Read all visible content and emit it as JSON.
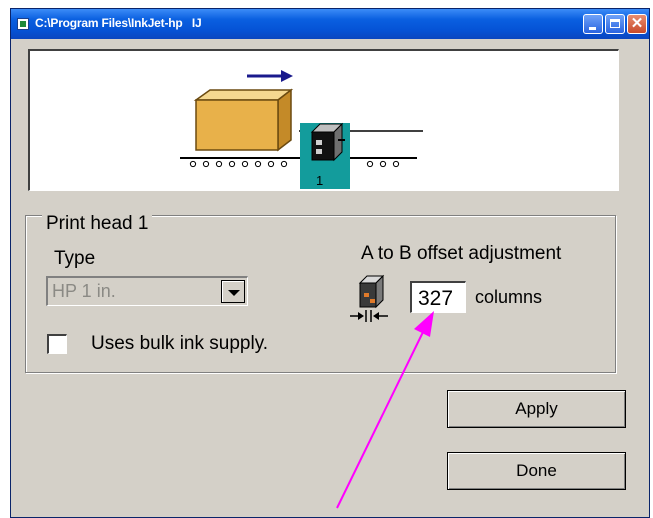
{
  "window": {
    "title": "C:\\Program Files\\InkJet-hp   IJ"
  },
  "animation": {
    "head_number": "1"
  },
  "print_head": {
    "group_label": "Print head 1",
    "type_label": "Type",
    "type_value": "HP 1 in.",
    "bulk_ink_label": "Uses bulk ink supply.",
    "bulk_ink_checked": false,
    "offset_label": "A to B offset adjustment",
    "offset_value": "327",
    "offset_unit": "columns"
  },
  "buttons": {
    "apply": "Apply",
    "done": "Done"
  },
  "colors": {
    "titlebar": "#0553d6",
    "box": "#e8b14a",
    "head_highlight": "#139c9c",
    "arrow_annotation": "#ff00ff",
    "direction_arrow": "#1a1a8c"
  }
}
